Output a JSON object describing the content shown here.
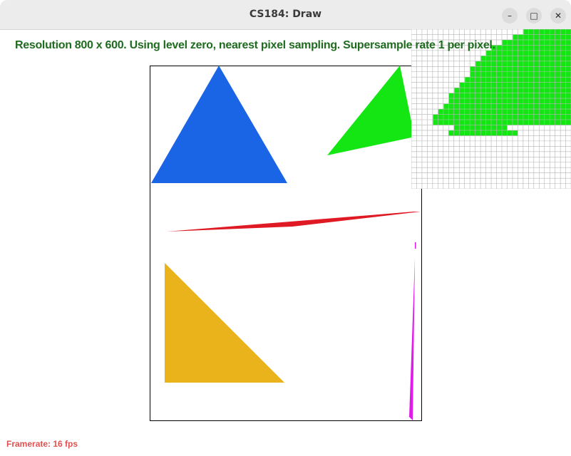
{
  "window": {
    "title": "CS184: Draw",
    "buttons": {
      "minimize": "–",
      "maximize": "□",
      "close": "✕"
    }
  },
  "status_text": "Resolution 800 x 600. Using level zero, nearest pixel sampling. Supersample rate 1 per pixel.",
  "framerate_text": "Framerate: 16 fps",
  "colors": {
    "status_text": "#1f6b1f",
    "framerate_text": "#e05050",
    "blue_triangle": "#1a65e6",
    "green_triangle": "#14e614",
    "red_triangle": "#e01a24",
    "yellow_triangle": "#eab31c",
    "magenta_triangle": "#e01aeb",
    "zoom_grid": "#b4b4b4"
  },
  "icons": {
    "minimize": "minimize-icon",
    "maximize": "maximize-icon",
    "close": "close-icon"
  }
}
